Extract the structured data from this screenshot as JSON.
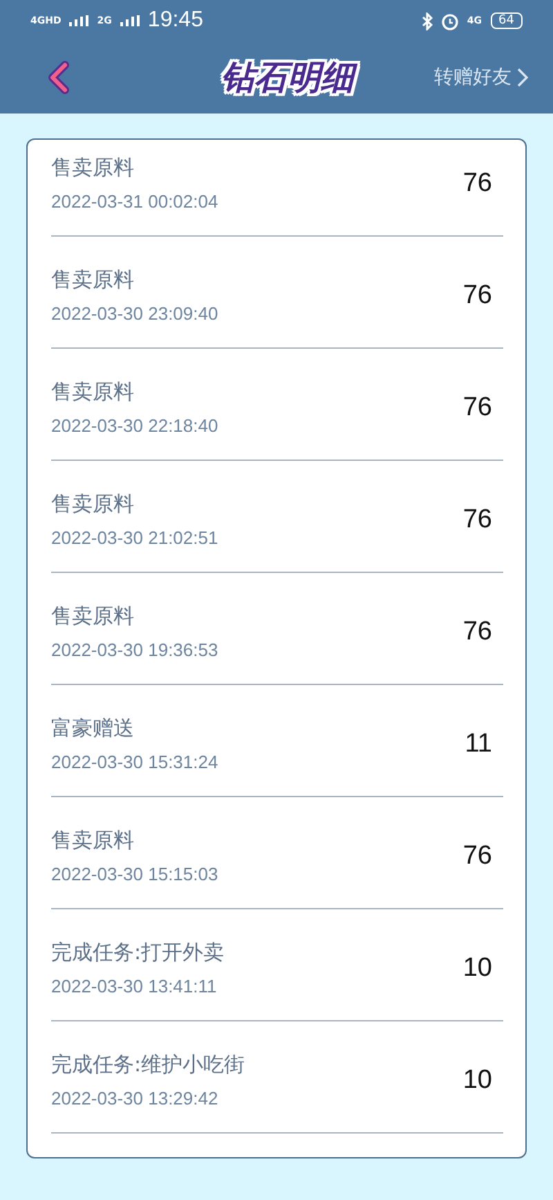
{
  "status_bar": {
    "signal_1": "4GHD",
    "signal_2": "2G",
    "time": "19:45",
    "network": "4G",
    "battery": "64"
  },
  "header": {
    "title": "钻石明细",
    "action": "转赠好友"
  },
  "records": [
    {
      "title": "售卖原料",
      "time": "2022-03-31 00:02:04",
      "amount": "76"
    },
    {
      "title": "售卖原料",
      "time": "2022-03-30 23:09:40",
      "amount": "76"
    },
    {
      "title": "售卖原料",
      "time": "2022-03-30 22:18:40",
      "amount": "76"
    },
    {
      "title": "售卖原料",
      "time": "2022-03-30 21:02:51",
      "amount": "76"
    },
    {
      "title": "售卖原料",
      "time": "2022-03-30 19:36:53",
      "amount": "76"
    },
    {
      "title": "富豪赠送",
      "time": "2022-03-30 15:31:24",
      "amount": "11"
    },
    {
      "title": "售卖原料",
      "time": "2022-03-30 15:15:03",
      "amount": "76"
    },
    {
      "title": "完成任务:打开外卖",
      "time": "2022-03-30 13:41:11",
      "amount": "10"
    },
    {
      "title": "完成任务:维护小吃街",
      "time": "2022-03-30 13:29:42",
      "amount": "10"
    }
  ]
}
